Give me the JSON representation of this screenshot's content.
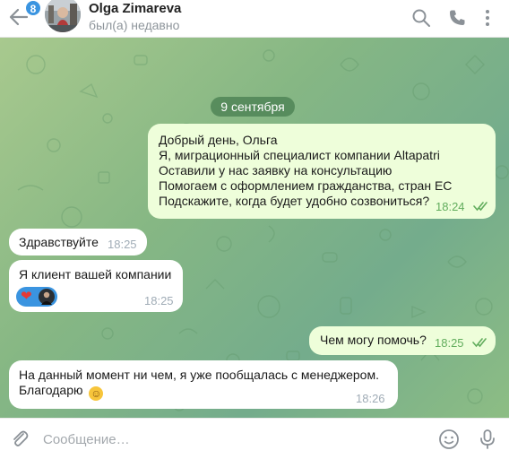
{
  "header": {
    "unread_badge": "8",
    "contact_name": "Olga Zimareva",
    "status": "был(а) недавно",
    "icons": [
      "back-arrow-icon",
      "search-icon",
      "phone-icon",
      "more-vertical-icon"
    ]
  },
  "chat": {
    "date_separator": "9 сентября",
    "messages": [
      {
        "direction": "outgoing",
        "lines": [
          "Добрый день, Ольга",
          "Я, миграционный специалист компании Altapatri",
          "Оставили у нас заявку на консультацию",
          "Помогаем с оформлением гражданства, стран ЕС",
          "Подскажите, когда будет удобно созвониться?"
        ],
        "time": "18:24",
        "read": true
      },
      {
        "direction": "incoming",
        "text": "Здравствуйте",
        "time": "18:25"
      },
      {
        "direction": "incoming",
        "text": "Я клиент вашей компании",
        "reaction": "❤",
        "time": "18:25"
      },
      {
        "direction": "outgoing",
        "text": "Чем могу помочь?",
        "time": "18:25",
        "read": true
      },
      {
        "direction": "incoming",
        "lines": [
          "На данный момент ни чем, я уже пообщалась с менеджером.",
          "Благодарю"
        ],
        "emoji": "☺",
        "time": "18:26"
      }
    ]
  },
  "composer": {
    "placeholder": "Сообщение…",
    "icons": [
      "attach-icon",
      "emoji-icon",
      "microphone-icon"
    ]
  },
  "colors": {
    "accent": "#3a94e0",
    "outgoing_bubble": "#eefeda",
    "incoming_bubble": "#ffffff",
    "date_pill": "#4d8354",
    "time_outgoing": "#62ad5d",
    "background_green": "#86b784"
  }
}
